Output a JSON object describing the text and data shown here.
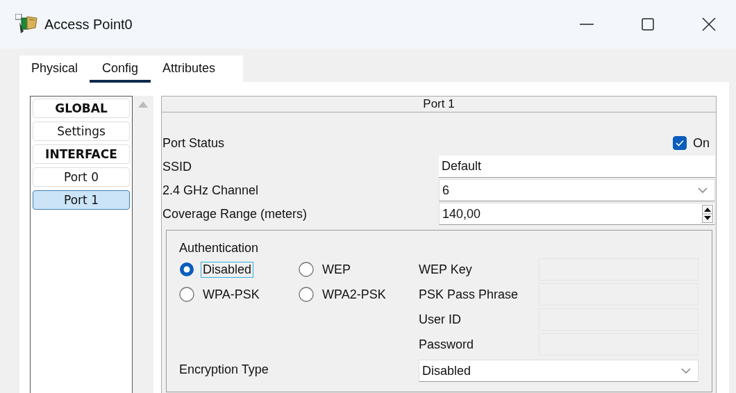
{
  "window": {
    "title": "Access Point0"
  },
  "tabs": [
    {
      "label": "Physical",
      "selected": false
    },
    {
      "label": "Config",
      "selected": true
    },
    {
      "label": "Attributes",
      "selected": false
    }
  ],
  "sidebar": {
    "items": [
      {
        "label": "GLOBAL",
        "kind": "header",
        "selected": false
      },
      {
        "label": "Settings",
        "kind": "item",
        "selected": false
      },
      {
        "label": "INTERFACE",
        "kind": "header",
        "selected": false
      },
      {
        "label": "Port 0",
        "kind": "item",
        "selected": false
      },
      {
        "label": "Port 1",
        "kind": "item",
        "selected": true
      }
    ]
  },
  "panel": {
    "title": "Port 1",
    "port_status": {
      "label": "Port Status",
      "checkbox_label": "On",
      "checked": true
    },
    "ssid": {
      "label": "SSID",
      "value": "Default"
    },
    "channel": {
      "label": "2.4 GHz Channel",
      "value": "6"
    },
    "coverage": {
      "label": "Coverage Range (meters)",
      "value": "140,00"
    },
    "authentication": {
      "title": "Authentication",
      "options": [
        {
          "label": "Disabled",
          "selected": true,
          "focused": true
        },
        {
          "label": "WEP",
          "selected": false,
          "focused": false
        },
        {
          "label": "WPA-PSK",
          "selected": false,
          "focused": false
        },
        {
          "label": "WPA2-PSK",
          "selected": false,
          "focused": false
        }
      ],
      "fields": [
        {
          "label": "WEP Key",
          "disabled": true
        },
        {
          "label": "PSK Pass Phrase",
          "disabled": true
        },
        {
          "label": "User ID",
          "disabled": true
        },
        {
          "label": "Password",
          "disabled": true
        }
      ],
      "encryption": {
        "label": "Encryption Type",
        "value": "Disabled"
      }
    }
  }
}
